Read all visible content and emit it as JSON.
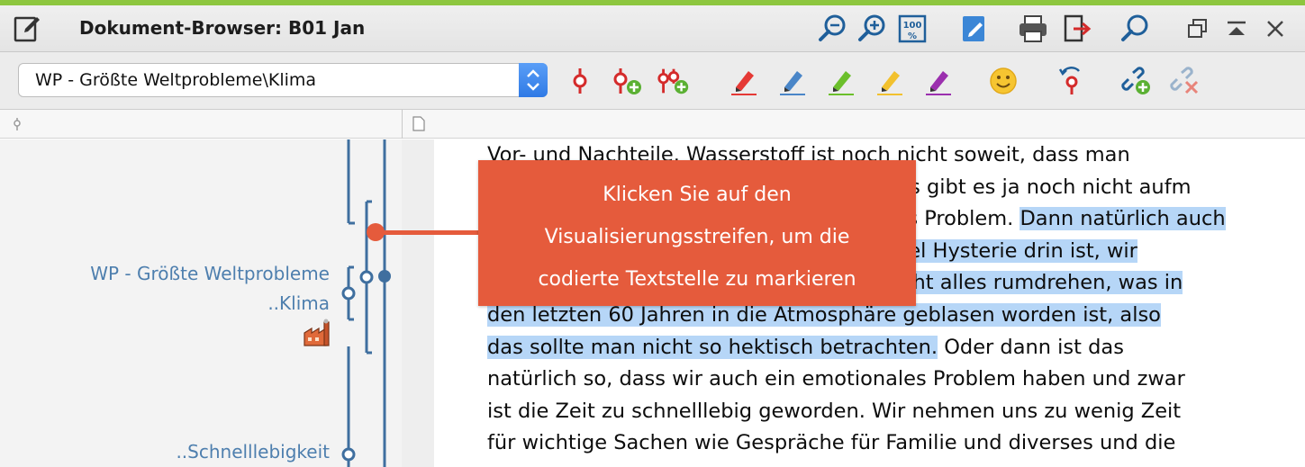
{
  "window": {
    "title": "Dokument-Browser: B01 Jan",
    "accent_color": "#8dc63f"
  },
  "titlebar_buttons": [
    {
      "name": "zoom-out-icon",
      "label": "zoom out"
    },
    {
      "name": "zoom-in-icon",
      "label": "zoom in"
    },
    {
      "name": "zoom-100-icon",
      "label": "100"
    },
    {
      "name": "edit-mode-icon",
      "label": "edit"
    },
    {
      "name": "print-icon",
      "label": "print"
    },
    {
      "name": "export-icon",
      "label": "export"
    },
    {
      "name": "search-icon",
      "label": "search"
    },
    {
      "name": "restore-window-icon",
      "label": "restore"
    },
    {
      "name": "collapse-icon",
      "label": "collapse"
    },
    {
      "name": "close-icon",
      "label": "close"
    }
  ],
  "zoom_reset_label": "100",
  "toolbar": {
    "code_select_value": "WP - Größte Weltprobleme\\Klima",
    "tools": [
      "code-icon",
      "code-new-icon",
      "code-multi-new-icon",
      "highlighter-red-icon",
      "highlighter-blue-icon",
      "highlighter-green-icon",
      "highlighter-yellow-icon",
      "highlighter-purple-icon",
      "emoticon-icon",
      "recode-icon",
      "link-add-icon",
      "link-remove-icon"
    ],
    "highlight_colors": {
      "red": "#e53935",
      "blue": "#4a86c8",
      "green": "#6bbf2b",
      "yellow": "#f2c12e",
      "purple": "#9b2fae"
    }
  },
  "coding_stripe": {
    "labels": [
      {
        "text": "WP - Größte Weltprobleme"
      },
      {
        "text": "..Klima"
      },
      {
        "text": "..Schnelllebigkeit"
      }
    ],
    "stripe_color": "#3f6f9f"
  },
  "document": {
    "lines": [
      {
        "segments": [
          {
            "text": "Vor- und Nachteile. Wasserstoff ist noch nicht soweit, dass man",
            "hl": false
          }
        ]
      },
      {
        "segments": [
          {
            "text": "es breitflächig einsetzen könnte, denn Das gibt es ja noch nicht aufm",
            "hl": false
          }
        ]
      },
      {
        "segments": [
          {
            "text": "Markt. Also das ist ja auch ein technisches Problem. ",
            "hl": false
          },
          {
            "text": "Dann natürlich auch",
            "hl": true
          }
        ]
      },
      {
        "segments": [
          {
            "text": "die Zeit, da ist glaube ich, ein bisschen viel Hysterie drin ist, wir",
            "hl": true
          }
        ]
      },
      {
        "segments": [
          {
            "text": "können ja in den nächsten fünfzig Jahr nicht alles rumdrehen, was in",
            "hl": true
          }
        ]
      },
      {
        "segments": [
          {
            "text": "den letzten 60 Jahren in die Atmosphäre geblasen worden ist, also",
            "hl": true
          }
        ]
      },
      {
        "segments": [
          {
            "text": "das sollte man nicht so hektisch betrachten.",
            "hl": true
          },
          {
            "text": " Oder dann ist das",
            "hl": false
          }
        ]
      },
      {
        "segments": [
          {
            "text": "natürlich so, dass wir auch ein emotionales Problem haben und zwar",
            "hl": false
          }
        ]
      },
      {
        "segments": [
          {
            "text": "ist die Zeit zu schnelllebig geworden. Wir nehmen uns zu wenig Zeit",
            "hl": false
          }
        ]
      },
      {
        "segments": [
          {
            "text": "für wichtige Sachen wie Gespräche für Familie und diverses und die",
            "hl": false
          }
        ]
      }
    ]
  },
  "callout": {
    "lines": [
      "Klicken Sie auf den",
      "Visualisierungsstreifen, um die",
      "codierte Textstelle zu markieren"
    ],
    "color": "#e55b3c"
  }
}
